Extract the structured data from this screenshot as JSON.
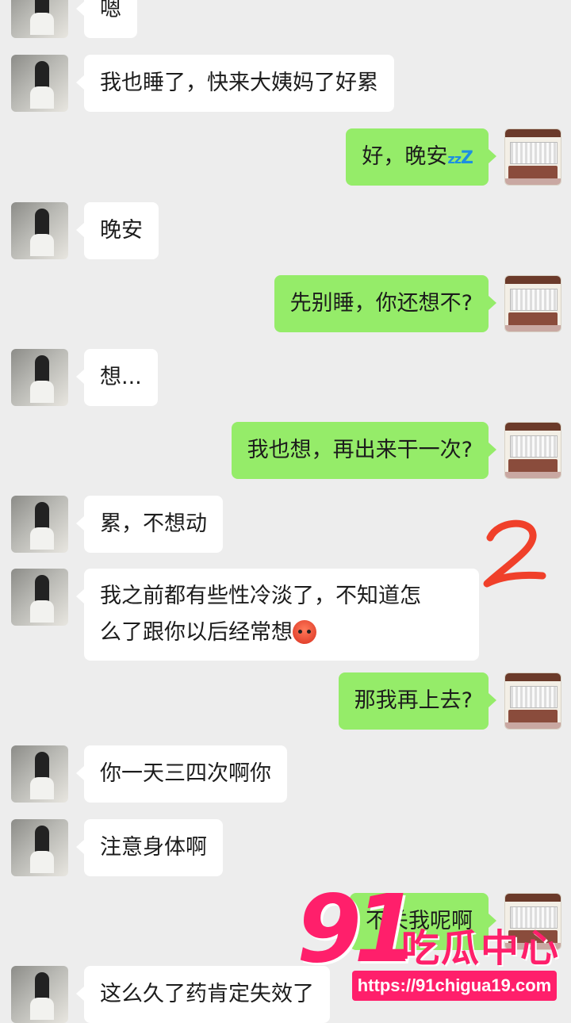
{
  "messages": [
    {
      "side": "left",
      "text": "嗯"
    },
    {
      "side": "left",
      "text": "我也睡了，快来大姨妈了好累"
    },
    {
      "side": "right",
      "text": "好，晚安",
      "suffix_icon": "sleeping-zzz-emoji"
    },
    {
      "side": "left",
      "text": "晚安"
    },
    {
      "side": "right",
      "text": "先别睡，你还想不?"
    },
    {
      "side": "left",
      "text": "想..."
    },
    {
      "side": "right",
      "text": "我也想，再出来干一次?"
    },
    {
      "side": "left",
      "text": "累，不想动"
    },
    {
      "side": "left",
      "text_line1": "我之前都有些性冷淡了，不知道怎",
      "text_line2": "么了跟你以后经常想",
      "suffix_icon": "blushing-face-emoji"
    },
    {
      "side": "right",
      "text": "那我再上去?"
    },
    {
      "side": "left",
      "text": "你一天三四次啊你"
    },
    {
      "side": "left",
      "text": "注意身体啊"
    },
    {
      "side": "right",
      "text": "不关我呢啊",
      "partially_obscured": true
    },
    {
      "side": "left",
      "text": "这么久了药肯定失效了"
    }
  ],
  "zzz_text": {
    "z1": "z",
    "z2": "z",
    "z3": "Z"
  },
  "annotation": {
    "mark": "2",
    "color": "#f0402a"
  },
  "watermark": {
    "number": "91",
    "brand": "吃瓜中心",
    "url": "https://91chigua19.com",
    "color": "#ff1f6b"
  },
  "colors": {
    "background": "#ededed",
    "left_bubble": "#ffffff",
    "right_bubble": "#95ec69"
  }
}
